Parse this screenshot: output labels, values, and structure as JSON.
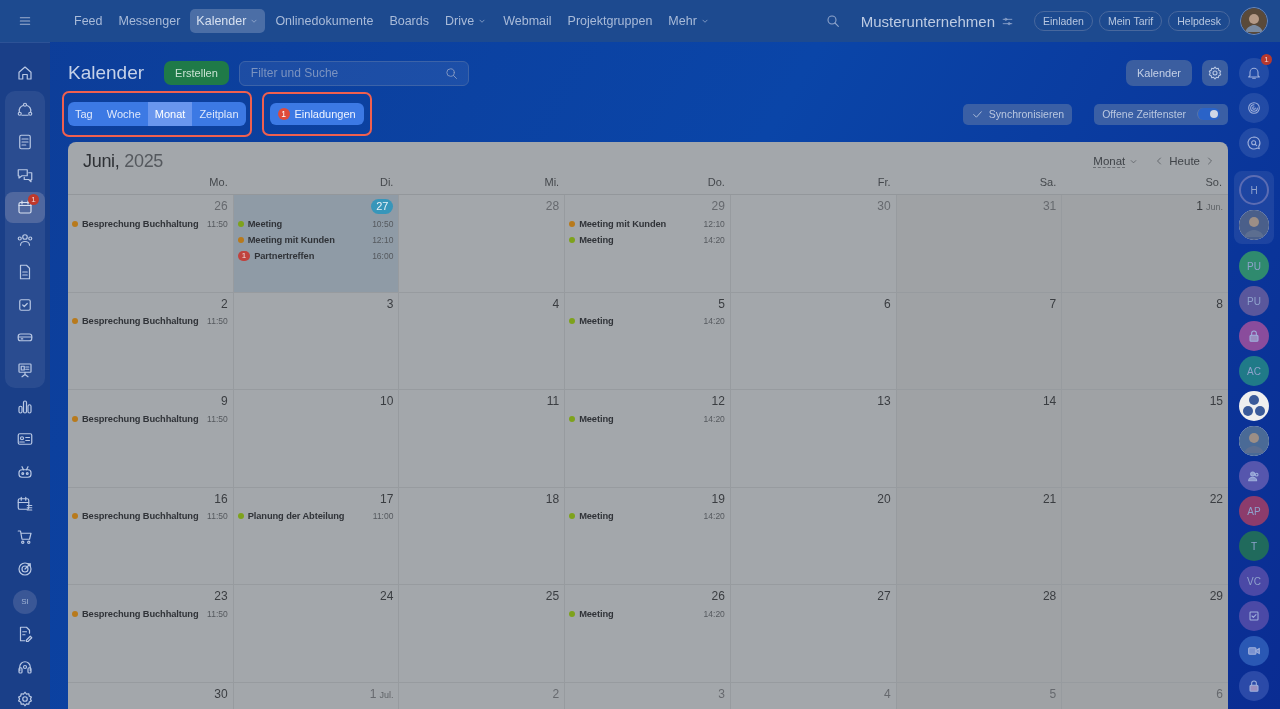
{
  "topbar": {
    "nav": [
      {
        "label": "Feed",
        "selected": false,
        "dropdown": false
      },
      {
        "label": "Messenger",
        "selected": false,
        "dropdown": false
      },
      {
        "label": "Kalender",
        "selected": true,
        "dropdown": true
      },
      {
        "label": "Onlinedokumente",
        "selected": false,
        "dropdown": false
      },
      {
        "label": "Boards",
        "selected": false,
        "dropdown": false
      },
      {
        "label": "Drive",
        "selected": false,
        "dropdown": true
      },
      {
        "label": "Webmail",
        "selected": false,
        "dropdown": false
      },
      {
        "label": "Projektgruppen",
        "selected": false,
        "dropdown": false
      },
      {
        "label": "Mehr",
        "selected": false,
        "dropdown": true
      }
    ],
    "company": "Musterunternehmen",
    "buttons": [
      "Einladen",
      "Mein Tarif",
      "Helpdesk"
    ]
  },
  "sidebar": {
    "sections": [
      {
        "items": [
          {
            "kind": "home",
            "selected": false
          }
        ]
      },
      {
        "framed": true,
        "items": [
          {
            "kind": "flow",
            "selected": false
          },
          {
            "kind": "news",
            "selected": false
          },
          {
            "kind": "chat",
            "selected": false
          },
          {
            "kind": "calendar",
            "selected": true,
            "badge": "1"
          },
          {
            "kind": "people",
            "selected": false
          },
          {
            "kind": "doc",
            "selected": false
          },
          {
            "kind": "task",
            "selected": false
          },
          {
            "kind": "drive",
            "selected": false
          },
          {
            "kind": "board",
            "selected": false
          }
        ]
      },
      {
        "items": [
          {
            "kind": "chart",
            "selected": false
          },
          {
            "kind": "card",
            "selected": false
          },
          {
            "kind": "robot",
            "selected": false
          },
          {
            "kind": "schedule",
            "selected": false
          },
          {
            "kind": "cart",
            "selected": false
          },
          {
            "kind": "target",
            "selected": false
          },
          {
            "kind": "initials",
            "label": "SI",
            "selected": false
          },
          {
            "kind": "docedit",
            "selected": false
          },
          {
            "kind": "headset",
            "selected": false
          },
          {
            "kind": "settings",
            "selected": false
          }
        ]
      }
    ]
  },
  "page": {
    "title": "Kalender",
    "create_button": "Erstellen",
    "search": {
      "placeholder": "Filter und Suche"
    },
    "calendar_button": "Kalender"
  },
  "view_switch": {
    "highlighted": true,
    "options": [
      {
        "label": "Tag",
        "selected": false
      },
      {
        "label": "Woche",
        "selected": false
      },
      {
        "label": "Monat",
        "selected": true
      },
      {
        "label": "Zeitplan",
        "selected": false
      }
    ]
  },
  "invitations": {
    "highlighted": true,
    "label": "Einladungen",
    "badge": "1"
  },
  "sync_button": "Synchronisieren",
  "open_slots": {
    "label": "Offene Zeitfenster",
    "on": true
  },
  "calendar": {
    "month": "Juni,",
    "year": "2025",
    "view_select": "Monat",
    "today_button": "Heute",
    "weekdays": [
      "Mo.",
      "Di.",
      "Mi.",
      "Do.",
      "Fr.",
      "Sa.",
      "So."
    ],
    "weeks": [
      [
        {
          "day": "26",
          "other_month": true,
          "events": [
            {
              "kind": "dot",
              "title": "Besprechung Buchhaltung",
              "time": "11:50",
              "color": "#b87a1c"
            }
          ]
        },
        {
          "day": "27",
          "today": true,
          "events": [
            {
              "kind": "dot",
              "title": "Meeting",
              "time": "10:50",
              "color": "#7ea21c"
            },
            {
              "kind": "dot",
              "title": "Meeting mit Kunden",
              "time": "12:10",
              "color": "#b87a1c"
            },
            {
              "kind": "badge",
              "badge": "1",
              "title": "Partnertreffen",
              "time": "16:00"
            }
          ]
        },
        {
          "day": "28",
          "other_month": true
        },
        {
          "day": "29",
          "other_month": true,
          "events": [
            {
              "kind": "dot",
              "title": "Meeting mit Kunden",
              "time": "12:10",
              "color": "#b87a1c"
            },
            {
              "kind": "dot",
              "title": "Meeting",
              "time": "14:20",
              "color": "#7ea21c"
            }
          ]
        },
        {
          "day": "30",
          "other_month": true
        },
        {
          "day": "31",
          "other_month": true
        },
        {
          "day": "1",
          "month": "Jun.",
          "other_month": false
        }
      ],
      [
        {
          "day": "2",
          "other_month": false,
          "events": [
            {
              "kind": "dot",
              "title": "Besprechung Buchhaltung",
              "time": "11:50",
              "color": "#b87a1c"
            }
          ]
        },
        {
          "day": "3",
          "other_month": false
        },
        {
          "day": "4",
          "other_month": false
        },
        {
          "day": "5",
          "other_month": false,
          "events": [
            {
              "kind": "dot",
              "title": "Meeting",
              "time": "14:20",
              "color": "#7ea21c"
            }
          ]
        },
        {
          "day": "6",
          "other_month": false
        },
        {
          "day": "7",
          "other_month": false
        },
        {
          "day": "8",
          "other_month": false
        }
      ],
      [
        {
          "day": "9",
          "other_month": false,
          "events": [
            {
              "kind": "dot",
              "title": "Besprechung Buchhaltung",
              "time": "11:50",
              "color": "#b87a1c"
            }
          ]
        },
        {
          "day": "10",
          "other_month": false
        },
        {
          "day": "11",
          "other_month": false
        },
        {
          "day": "12",
          "other_month": false,
          "events": [
            {
              "kind": "dot",
              "title": "Meeting",
              "time": "14:20",
              "color": "#7ea21c"
            }
          ]
        },
        {
          "day": "13",
          "other_month": false
        },
        {
          "day": "14",
          "other_month": false
        },
        {
          "day": "15",
          "other_month": false
        }
      ],
      [
        {
          "day": "16",
          "other_month": false,
          "events": [
            {
              "kind": "dot",
              "title": "Besprechung Buchhaltung",
              "time": "11:50",
              "color": "#b87a1c"
            }
          ]
        },
        {
          "day": "17",
          "other_month": false,
          "events": [
            {
              "kind": "dot",
              "title": "Planung der Abteilung",
              "time": "11:00",
              "color": "#7ea21c"
            }
          ]
        },
        {
          "day": "18",
          "other_month": false
        },
        {
          "day": "19",
          "other_month": false,
          "events": [
            {
              "kind": "dot",
              "title": "Meeting",
              "time": "14:20",
              "color": "#7ea21c"
            }
          ]
        },
        {
          "day": "20",
          "other_month": false
        },
        {
          "day": "21",
          "other_month": false
        },
        {
          "day": "22",
          "other_month": false
        }
      ],
      [
        {
          "day": "23",
          "other_month": false,
          "events": [
            {
              "kind": "dot",
              "title": "Besprechung Buchhaltung",
              "time": "11:50",
              "color": "#b87a1c"
            }
          ]
        },
        {
          "day": "24",
          "other_month": false
        },
        {
          "day": "25",
          "other_month": false
        },
        {
          "day": "26",
          "other_month": false,
          "events": [
            {
              "kind": "dot",
              "title": "Meeting",
              "time": "14:20",
              "color": "#7ea21c"
            }
          ]
        },
        {
          "day": "27",
          "other_month": false
        },
        {
          "day": "28",
          "other_month": false
        },
        {
          "day": "29",
          "other_month": false
        }
      ],
      [
        {
          "day": "30",
          "other_month": false
        },
        {
          "day": "1",
          "month": "Jul.",
          "other_month": true
        },
        {
          "day": "2",
          "other_month": true
        },
        {
          "day": "3",
          "other_month": true
        },
        {
          "day": "4",
          "other_month": true
        },
        {
          "day": "5",
          "other_month": true
        },
        {
          "day": "6",
          "other_month": true
        }
      ]
    ]
  },
  "rightbar": {
    "top": [
      {
        "kind": "bell",
        "badge": "1"
      },
      {
        "kind": "spiral"
      },
      {
        "kind": "chatsearch"
      }
    ],
    "pinned": [
      {
        "kind": "initials",
        "label": "H",
        "color": "#5b6cb3"
      },
      {
        "kind": "photo",
        "color": "#4a5f8a"
      }
    ],
    "chats": [
      {
        "kind": "initials",
        "label": "PU",
        "color": "#2f8a6e"
      },
      {
        "kind": "initials",
        "label": "PU",
        "color": "#5a579c"
      },
      {
        "kind": "lock",
        "color": "#8a4c9c"
      },
      {
        "kind": "initials",
        "label": "AC",
        "color": "#207a88"
      },
      {
        "kind": "group",
        "color": "#3a5a9a"
      },
      {
        "kind": "photo",
        "color": "#4a6a96"
      },
      {
        "kind": "people",
        "color": "#5656ad"
      },
      {
        "kind": "initials",
        "label": "AP",
        "color": "#8c3c6c"
      },
      {
        "kind": "initials",
        "label": "T",
        "color": "#206a5c"
      },
      {
        "kind": "initials",
        "label": "VC",
        "color": "#4b49a6"
      },
      {
        "kind": "check",
        "color": "#4b49a6"
      },
      {
        "kind": "video",
        "color": "#2a58b4"
      },
      {
        "kind": "lock",
        "color": "#2b4aa8"
      }
    ]
  }
}
